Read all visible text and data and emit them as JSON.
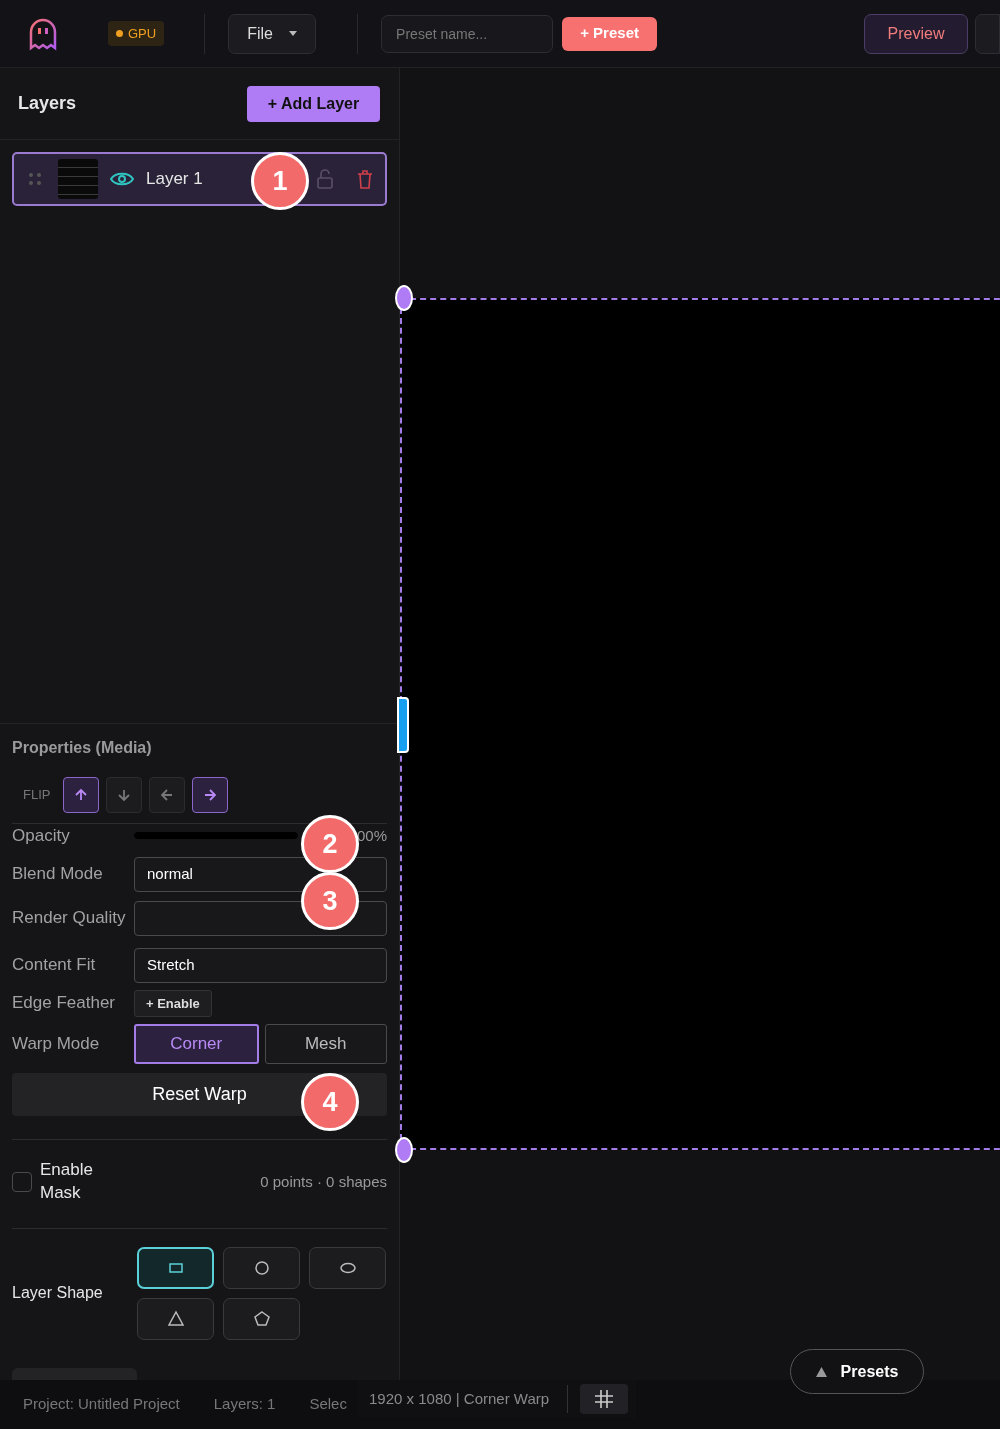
{
  "toolbar": {
    "gpu_badge": "GPU",
    "file_menu": "File",
    "preset_name": {
      "placeholder": "Preset name..."
    },
    "add_preset": "+ Preset",
    "preview": "Preview"
  },
  "layers_panel": {
    "title": "Layers",
    "add_button": "+ Add Layer",
    "layers": [
      {
        "name": "Layer 1",
        "selected": true,
        "visible": true,
        "locked": false
      }
    ]
  },
  "properties": {
    "title": "Properties (Media)",
    "flip_label": "FLIP",
    "flip_buttons": [
      {
        "kind": "up",
        "selected": true
      },
      {
        "kind": "down",
        "selected": false
      },
      {
        "kind": "left",
        "selected": false
      },
      {
        "kind": "right",
        "selected": true
      }
    ],
    "opacity": {
      "label": "Opacity",
      "level": 1,
      "reading": "00%"
    },
    "blend_mode": {
      "label": "Blend Mode",
      "value": "normal"
    },
    "render_quality": {
      "label": "Render Quality"
    },
    "content_fit": {
      "label": "Content Fit",
      "value": "Stretch"
    },
    "edge_feather": {
      "label": "Edge Feather",
      "button": "+ Enable"
    },
    "warp_mode": {
      "label": "Warp Mode",
      "options": [
        {
          "label": "Corner",
          "selected": true
        },
        {
          "label": "Mesh",
          "selected": false
        }
      ]
    },
    "reset_warp": "Reset Warp",
    "mask": {
      "label": "Enable Mask",
      "checked": false,
      "summary": "0 points · 0 shapes"
    },
    "layer_shape": {
      "label": "Layer Shape",
      "shapes": [
        {
          "kind": "rectangle",
          "selected": true
        },
        {
          "kind": "circle",
          "selected": false
        },
        {
          "kind": "ellipse",
          "selected": false
        },
        {
          "kind": "triangle",
          "selected": false
        },
        {
          "kind": "pentagon",
          "selected": false
        }
      ]
    }
  },
  "canvas": {
    "info": "1920 x 1080 | Corner Warp",
    "presets_button": "Presets"
  },
  "status_bar": {
    "items": [
      "Project: Untitled Project",
      "Layers: 1",
      "Selec"
    ]
  },
  "callouts": [
    "1",
    "2",
    "3",
    "4"
  ]
}
